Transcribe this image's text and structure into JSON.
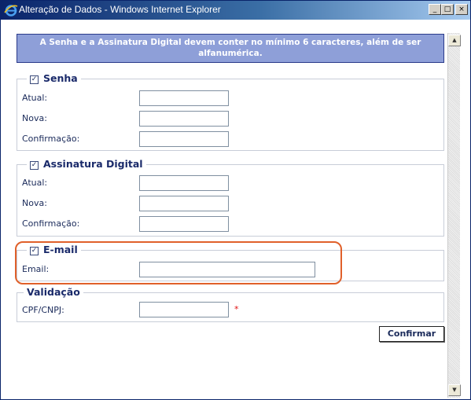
{
  "window": {
    "title": "Alteração de Dados - Windows Internet Explorer",
    "controls": {
      "minimize": "_",
      "maximize": "□",
      "close": "×"
    }
  },
  "banner": {
    "line1": "A Senha e a Assinatura Digital devem conter no mínimo 6 caracteres, além de ser",
    "line2": "alfanumérica."
  },
  "senha": {
    "legend": "Senha",
    "checked": true,
    "atual_label": "Atual:",
    "nova_label": "Nova:",
    "confirmacao_label": "Confirmação:",
    "atual_value": "",
    "nova_value": "",
    "confirmacao_value": ""
  },
  "assinatura": {
    "legend": "Assinatura Digital",
    "checked": true,
    "atual_label": "Atual:",
    "nova_label": "Nova:",
    "confirmacao_label": "Confirmação:",
    "atual_value": "",
    "nova_value": "",
    "confirmacao_value": ""
  },
  "email": {
    "legend": "E-mail",
    "checked": true,
    "label": "Email:",
    "value": ""
  },
  "validacao": {
    "legend": "Validação",
    "cpf_label": "CPF/CNPJ:",
    "cpf_value": "",
    "required_mark": "*"
  },
  "actions": {
    "confirm_label": "Confirmar"
  },
  "colors": {
    "banner_bg": "#8e9fd8",
    "highlight": "#e0602a",
    "required": "#e01010",
    "titlebar": "#0a246a"
  },
  "icons": {
    "browser": "ie-icon",
    "checkbox": "checkbox-checked-icon",
    "scroll_up": "scroll-up-arrow-icon",
    "scroll_down": "scroll-down-arrow-icon"
  }
}
